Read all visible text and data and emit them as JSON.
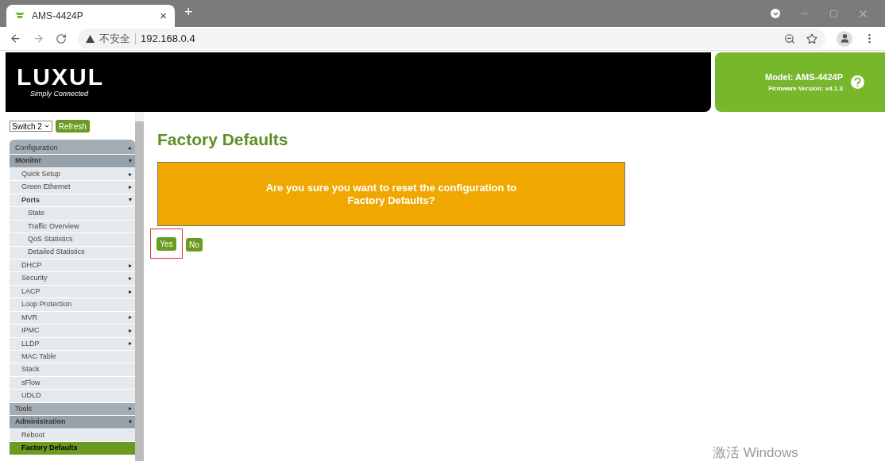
{
  "browser": {
    "tab": {
      "title": "AMS-4424P",
      "close": "×"
    },
    "new_tab": "+",
    "security_label": "不安全",
    "address": "192.168.0.4"
  },
  "header": {
    "logo_word": "LUXUL",
    "logo_tagline": "Simply Connected",
    "model": "Model: AMS-4424P",
    "firmware": "Firmware Version: v4.1.3"
  },
  "sidebar": {
    "switch_select": "Switch 2",
    "refresh_button": "Refresh",
    "menu": [
      {
        "label": "Configuration",
        "expanded": false,
        "selected": false
      },
      {
        "label": "Monitor",
        "expanded": true,
        "selected": false,
        "children": [
          {
            "label": "Quick Setup",
            "expanded": false,
            "selected": false
          },
          {
            "label": "Green Ethernet",
            "expanded": false,
            "selected": false
          },
          {
            "label": "Ports",
            "expanded": true,
            "selected": false,
            "children": [
              {
                "label": "State",
                "selected": false
              },
              {
                "label": "Traffic Overview",
                "selected": false
              },
              {
                "label": "QoS Statistics",
                "selected": false
              },
              {
                "label": "Detailed Statistics",
                "selected": false
              }
            ]
          },
          {
            "label": "DHCP",
            "expanded": false,
            "selected": false
          },
          {
            "label": "Security",
            "expanded": false,
            "selected": false
          },
          {
            "label": "LACP",
            "expanded": false,
            "selected": false
          },
          {
            "label": "Loop Protection",
            "selected": false
          },
          {
            "label": "MVR",
            "expanded": false,
            "selected": false
          },
          {
            "label": "IPMC",
            "expanded": false,
            "selected": false
          },
          {
            "label": "LLDP",
            "expanded": false,
            "selected": false
          },
          {
            "label": "MAC Table",
            "selected": false
          },
          {
            "label": "Stack",
            "selected": false
          },
          {
            "label": "sFlow",
            "selected": false
          },
          {
            "label": "UDLD",
            "selected": false
          }
        ]
      },
      {
        "label": "Tools",
        "expanded": false,
        "selected": false
      },
      {
        "label": "Administration",
        "expanded": true,
        "selected": false,
        "children": [
          {
            "label": "Reboot",
            "selected": false
          },
          {
            "label": "Factory Defaults",
            "selected": true
          }
        ]
      }
    ]
  },
  "content": {
    "title": "Factory Defaults",
    "message": "Are you sure you want to reset the configuration to Factory Defaults?",
    "buttons": [
      {
        "label": "Yes",
        "highlighted": true
      },
      {
        "label": "No",
        "highlighted": false
      }
    ]
  },
  "os_notice": "激活 Windows"
}
